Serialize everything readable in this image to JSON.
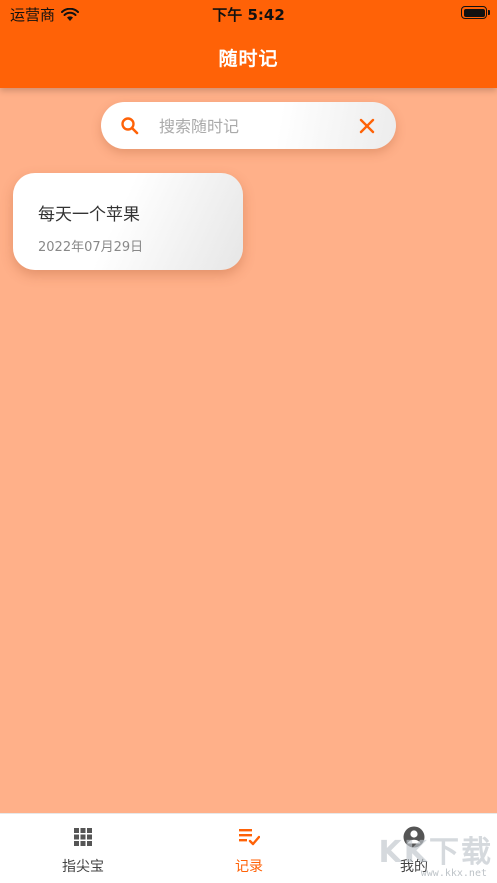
{
  "status_bar": {
    "carrier": "运营商",
    "time": "下午 5:42"
  },
  "header": {
    "title": "随时记"
  },
  "search": {
    "placeholder": "搜索随时记",
    "value": ""
  },
  "notes": [
    {
      "title": "每天一个苹果",
      "date": "2022年07月29日"
    }
  ],
  "tabbar": {
    "tabs": [
      {
        "label": "指尖宝",
        "icon": "grid-icon",
        "active": false
      },
      {
        "label": "记录",
        "icon": "checklist-icon",
        "active": true
      },
      {
        "label": "我的",
        "icon": "user-icon",
        "active": false
      }
    ]
  },
  "watermark": {
    "text": "KK下载",
    "url": "www.kkx.net"
  },
  "colors": {
    "primary": "#FF6207",
    "background": "#FFB089",
    "card": "#FFFFFF"
  }
}
